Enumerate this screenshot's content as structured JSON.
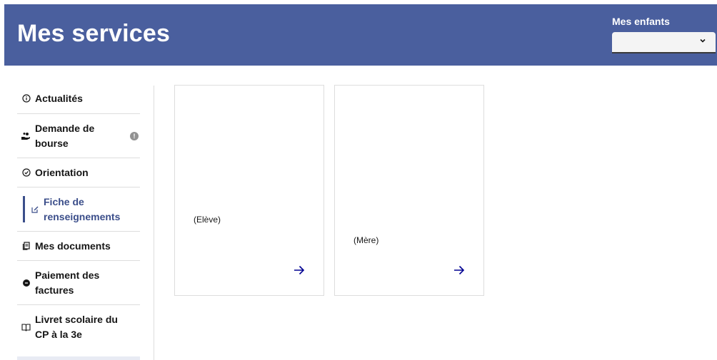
{
  "header": {
    "title": "Mes services",
    "children_label": "Mes enfants",
    "children_select_value": "",
    "background": "#4a5f9e"
  },
  "sidebar": {
    "items": [
      {
        "label": "Actualités",
        "icon": "info-circle-icon"
      },
      {
        "label": "Demande de bourse",
        "icon": "hand-coins-icon",
        "badge": "!"
      },
      {
        "label": "Orientation",
        "icon": "compass-icon"
      },
      {
        "label": "Fiche de renseignements",
        "icon": "edit-doc-icon",
        "active": true
      },
      {
        "label": "Mes documents",
        "icon": "documents-icon"
      },
      {
        "label": "Paiement des factures",
        "icon": "coin-icon"
      },
      {
        "label": "Livret scolaire du CP à la 3e",
        "icon": "book-icon"
      }
    ],
    "active_color": "#3b4e8a"
  },
  "cards": [
    {
      "subtitle": "(Elève)",
      "arrow_icon": "arrow-right-icon"
    },
    {
      "subtitle": "(Mère)",
      "arrow_icon": "arrow-right-icon"
    }
  ],
  "accent_color": "#000091"
}
